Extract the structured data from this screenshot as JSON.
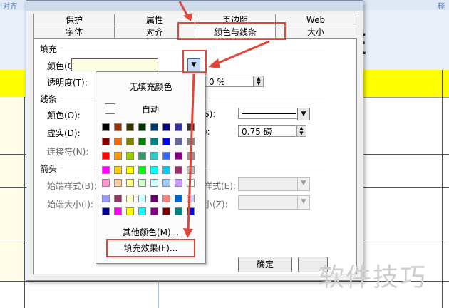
{
  "background": {
    "top_left_text": "对齐",
    "top_right_text": "释",
    "column_letter": "E",
    "highlight_color": "#ffff00"
  },
  "dialog": {
    "tabs_row1": [
      "保护",
      "属性",
      "页边距",
      "Web"
    ],
    "tabs_row2": [
      "字体",
      "对齐",
      "颜色与线条",
      "大小"
    ],
    "active_tab": "颜色与线条",
    "fill_section": "填充",
    "fill_color_label": "颜色(C):",
    "fill_color_value": "#fffde1",
    "transparency_label": "透明度(T):",
    "transparency_value": "0 %",
    "line_section": "线条",
    "line_color_label": "颜色(O):",
    "dash_label": "虚实(D):",
    "connector_label": "连接符(N):",
    "style_label_suffix": "S):",
    "weight_label_suffix": "):",
    "weight_value": "0.75 磅",
    "arrow_section": "箭头",
    "begin_style_label": "始端样式(B):",
    "begin_size_label": "始端大小(I):",
    "end_style_label_suffix": "样式(E):",
    "end_size_label_suffix": "小(Z):",
    "ok_button": "确定"
  },
  "color_popup": {
    "no_fill": "无填充颜色",
    "automatic": "自动",
    "more_colors": "其他颜色(M)...",
    "fill_effects": "填充效果(F)...",
    "palette_rows": [
      [
        "#000000",
        "#993300",
        "#333300",
        "#003300",
        "#003366",
        "#000080",
        "#333399",
        "#333333"
      ],
      [
        "#800000",
        "#ff6600",
        "#808000",
        "#008000",
        "#008080",
        "#0000ff",
        "#666699",
        "#808080"
      ],
      [
        "#ff0000",
        "#ff9900",
        "#99cc00",
        "#339966",
        "#33cccc",
        "#3366ff",
        "#800080",
        "#969696"
      ],
      [
        "#ff00ff",
        "#ffcc00",
        "#ffff00",
        "#00ff00",
        "#00ffff",
        "#00ccff",
        "#993366",
        "#c0c0c0"
      ],
      [
        "#ff99cc",
        "#ffcc99",
        "#ffff99",
        "#ccffcc",
        "#ccffff",
        "#99ccff",
        "#cc99ff",
        "#ffffff"
      ]
    ],
    "chart_rows": [
      [
        "#9999ff",
        "#993366",
        "#ffffcc",
        "#ccffff",
        "#660066",
        "#ff8080",
        "#0066cc",
        "#ccccff"
      ],
      [
        "#000080",
        "#ff00ff",
        "#ffff00",
        "#00ffff",
        "#800080",
        "#800000",
        "#008080",
        "#0000ff"
      ]
    ]
  },
  "annotation_color": "#e1463a",
  "watermark": "软件技巧"
}
